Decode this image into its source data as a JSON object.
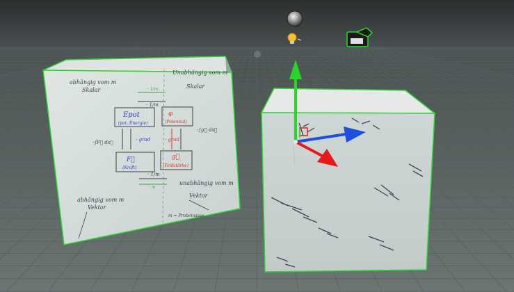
{
  "viewport": {
    "sky_color": "#3a3e40",
    "ground_color": "#5f6766",
    "grid_color": "#4b5352",
    "selection_outline_color": "#2fd52f"
  },
  "cube_left_face": {
    "top_left_note": "abhängig vom m",
    "top_left_note2": "Skalar",
    "top_right_note": "Unabhängig vom m",
    "top_right_note2": "Skalar",
    "arrow_top_label": "· 1/m",
    "arrow_top_label2": "· 1/m",
    "box_top_left_title": "Epot",
    "box_top_left_sub": "(pot. Energie)",
    "box_top_right_title": "φ",
    "box_top_right_sub": "(Potential)",
    "grad_left": "- grad",
    "grad_right": "- grad",
    "left_integral": "-∫F⃗ ds⃗",
    "right_integral": "-∫g⃗ ds⃗",
    "box_bottom_left_title": "F⃗",
    "box_bottom_left_sub": "(Kraft)",
    "box_bottom_right_title": "g⃗",
    "box_bottom_right_sub": "(Feldstärke)",
    "arrow_bottom_label": "· 1/m",
    "arrow_bottom_label2": "· m",
    "bottom_left_note": "abhängig vom m",
    "bottom_left_note2": "Vektor",
    "bottom_right_note": "unabhängig vom m",
    "bottom_right_note2": "Vektor",
    "footnote": "m = Probemasse"
  },
  "scene_icons": {
    "sphere": "reflection-probe-sphere-icon",
    "light": "light-bulb-icon",
    "camera": "camera-icon"
  },
  "gizmo": {
    "x_color": "#1f4fe0",
    "y_color": "#27d627",
    "z_color": "#e8181d"
  }
}
